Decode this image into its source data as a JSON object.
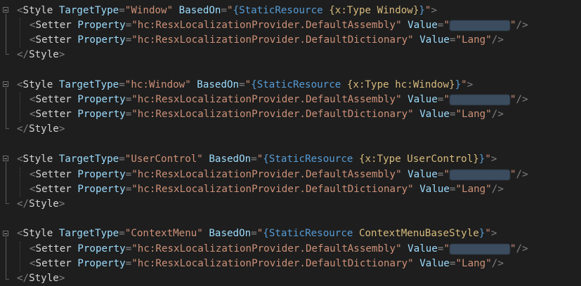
{
  "editor": {
    "blocks": [
      {
        "style_open_prefix": "<Style ",
        "target_attr": "TargetType",
        "target_value": "Window",
        "based_attr": "BasedOn",
        "based_open": "{StaticResource ",
        "based_type": "{x:Type Window}",
        "based_close": "}",
        "setters": [
          {
            "open": "<Setter ",
            "prop_attr": "Property",
            "prop_value": "hc:ResxLocalizationProvider.DefaultAssembly",
            "val_attr": "Value",
            "val_value": "",
            "close": "/>"
          },
          {
            "open": "<Setter ",
            "prop_attr": "Property",
            "prop_value": "hc:ResxLocalizationProvider.DefaultDictionary",
            "val_attr": "Value",
            "val_value": "Lang",
            "close": "/>"
          }
        ],
        "style_close": "</Style>"
      },
      {
        "style_open_prefix": "<Style ",
        "target_attr": "TargetType",
        "target_value": "hc:Window",
        "based_attr": "BasedOn",
        "based_open": "{StaticResource ",
        "based_type": "{x:Type hc:Window}",
        "based_close": "}",
        "setters": [
          {
            "open": "<Setter ",
            "prop_attr": "Property",
            "prop_value": "hc:ResxLocalizationProvider.DefaultAssembly",
            "val_attr": "Value",
            "val_value": "",
            "close": "/>"
          },
          {
            "open": "<Setter ",
            "prop_attr": "Property",
            "prop_value": "hc:ResxLocalizationProvider.DefaultDictionary",
            "val_attr": "Value",
            "val_value": "Lang",
            "close": "/>"
          }
        ],
        "style_close": "</Style>"
      },
      {
        "style_open_prefix": "<Style ",
        "target_attr": "TargetType",
        "target_value": "UserControl",
        "based_attr": "BasedOn",
        "based_open": "{StaticResource ",
        "based_type": "{x:Type UserControl}",
        "based_close": "}",
        "setters": [
          {
            "open": "<Setter ",
            "prop_attr": "Property",
            "prop_value": "hc:ResxLocalizationProvider.DefaultAssembly",
            "val_attr": "Value",
            "val_value": "",
            "close": "/>"
          },
          {
            "open": "<Setter ",
            "prop_attr": "Property",
            "prop_value": "hc:ResxLocalizationProvider.DefaultDictionary",
            "val_attr": "Value",
            "val_value": "Lang",
            "close": "/>"
          }
        ],
        "style_close": "</Style>"
      },
      {
        "style_open_prefix": "<Style ",
        "target_attr": "TargetType",
        "target_value": "ContextMenu",
        "based_attr": "BasedOn",
        "based_open": "{StaticResource ",
        "based_type": "ContextMenuBaseStyle",
        "based_close": "}",
        "setters": [
          {
            "open": "<Setter ",
            "prop_attr": "Property",
            "prop_value": "hc:ResxLocalizationProvider.DefaultAssembly",
            "val_attr": "Value",
            "val_value": "",
            "close": "/>"
          },
          {
            "open": "<Setter ",
            "prop_attr": "Property",
            "prop_value": "hc:ResxLocalizationProvider.DefaultDictionary",
            "val_attr": "Value",
            "val_value": "Lang",
            "close": "/>"
          }
        ],
        "style_close": "</Style>"
      }
    ],
    "colors": {
      "background": "#1e1e1e",
      "punctuation": "#808080",
      "tag": "#d4d4d4",
      "attribute": "#9cdcfe",
      "string": "#ce9178",
      "markup_extension": "#569cd6",
      "type_name": "#d7ba7d"
    },
    "icons": {
      "fold": "fold-collapse-icon"
    }
  }
}
